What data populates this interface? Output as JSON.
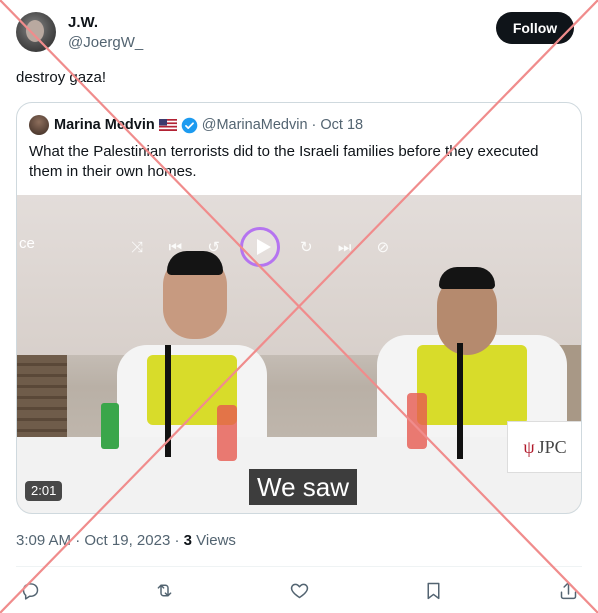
{
  "author": {
    "name": "J.W.",
    "handle": "@JoergW_"
  },
  "follow_label": "Follow",
  "tweet_text": "destroy gaza!",
  "quoted": {
    "name": "Marina Medvin",
    "handle": "@MarinaMedvin",
    "separator": "·",
    "date": "Oct 18",
    "text": "What the Palestinian terrorists did to the Israeli families before they executed them in their own homes.",
    "video": {
      "screen_text": "ce",
      "caption": "We saw",
      "duration": "2:01",
      "sign_text": "JPC"
    }
  },
  "meta": {
    "time": "3:09 AM",
    "separator": "·",
    "date": "Oct 19, 2023",
    "separator2": "·",
    "views_count": "3",
    "views_label": "Views"
  },
  "colors": {
    "overlay_x": "#f08c8c",
    "verified": "#1d9bf0",
    "text_secondary": "#536471"
  },
  "icons": {
    "reply": "reply-icon",
    "retweet": "retweet-icon",
    "like": "like-icon",
    "bookmark": "bookmark-icon",
    "share": "share-icon"
  }
}
